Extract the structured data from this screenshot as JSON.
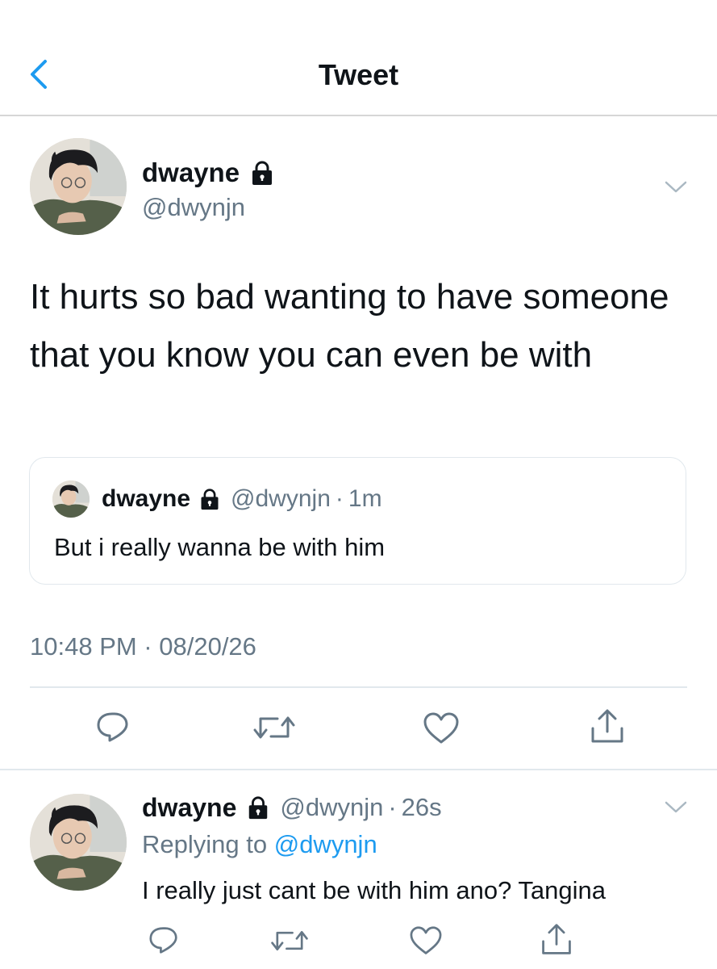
{
  "header": {
    "title": "Tweet"
  },
  "main_tweet": {
    "display_name": "dwayne",
    "handle": "@dwynjn",
    "text": "It hurts so bad wanting to have someone that you know you can even be with",
    "quote": {
      "display_name": "dwayne",
      "handle": "@dwynjn",
      "separator": "·",
      "time": "1m",
      "text": "But i really wanna be with him"
    },
    "timestamp": "10:48 PM · 08/20/26"
  },
  "reply": {
    "display_name": "dwayne",
    "handle": "@dwynjn",
    "separator": "·",
    "time": "26s",
    "replying_prefix": "Replying to",
    "replying_to": "@dwynjn",
    "text": "I really just cant be with him ano? Tangina"
  },
  "icons": {
    "back": "chevron-left-icon",
    "more": "chevron-down-icon",
    "lock": "lock-icon",
    "reply": "reply-icon",
    "retweet": "retweet-icon",
    "like": "heart-icon",
    "share": "share-icon"
  },
  "colors": {
    "accent": "#1d9bf0",
    "secondary_text": "#657786",
    "divider": "#e1e8ed"
  }
}
